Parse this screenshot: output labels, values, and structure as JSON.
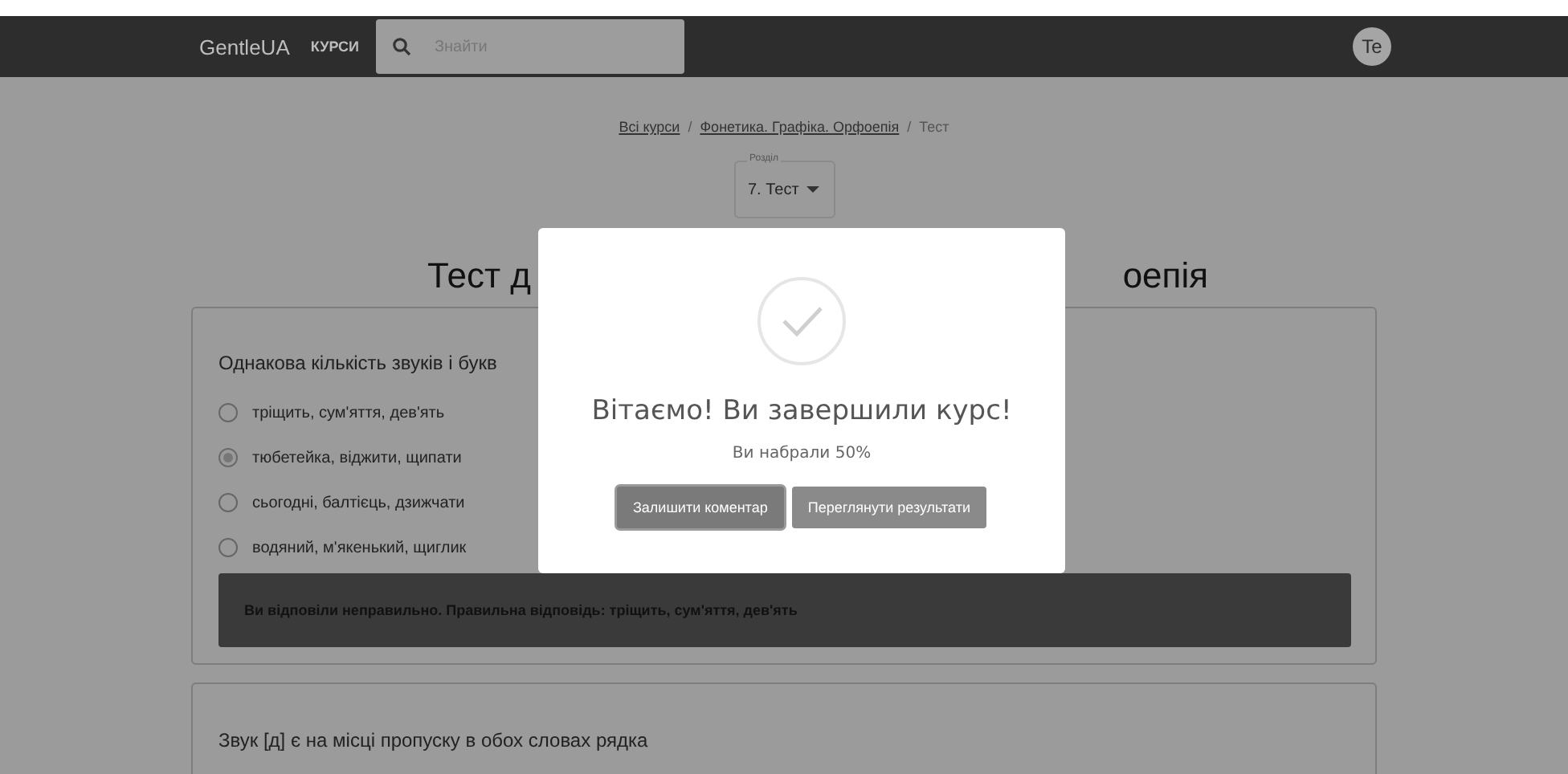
{
  "navbar": {
    "brand": "GentleUA",
    "link": "КУРСИ",
    "search": {
      "placeholder": "Знайти"
    },
    "avatar": "Te"
  },
  "breadcrumb": [
    {
      "label": "Всі курси",
      "kind": "link"
    },
    {
      "label": "/",
      "kind": "separator"
    },
    {
      "label": "Фонетика. Графіка. Орфоепія",
      "kind": "link"
    },
    {
      "label": "/",
      "kind": "separator"
    },
    {
      "label": "Тест",
      "kind": "current"
    }
  ],
  "section_select": {
    "legend": "Розділ",
    "value": "7. Тест"
  },
  "title_visible_parts": [
    "Тест д",
    "оепія"
  ],
  "questions": [
    {
      "text": "Однакова кількість звуків і букв",
      "options": [
        {
          "label": "тріщить, сум'яття, дев'ять",
          "selected": false
        },
        {
          "label": "тюбетейка, віджити, щипати",
          "selected": true
        },
        {
          "label": "сьогодні, балтієць, дзижчати",
          "selected": false
        },
        {
          "label": "водяний, м'якенький, щиглик",
          "selected": false
        }
      ],
      "feedback": "Ви відповіли неправильно. Правильна відповідь: тріщить, сум'яття, дев'ять"
    },
    {
      "text": "Звук [д] є на місці пропуску в обох словах рядка"
    }
  ],
  "dialog": {
    "title": "Вітаємо! Ви завершили курс!",
    "message": "Ви набрали 50%",
    "buttons": [
      {
        "label": "Залишити коментар",
        "kind": "primary"
      },
      {
        "label": "Переглянути результати",
        "kind": "secondary"
      }
    ]
  }
}
